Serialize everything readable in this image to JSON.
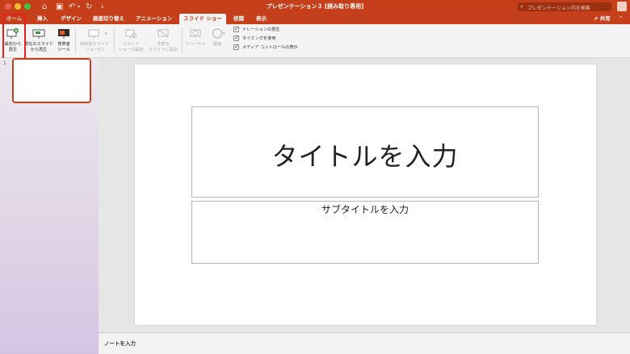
{
  "window": {
    "title": "プレゼンテーション３ [読み取り専用]",
    "search_placeholder": "プレゼンテーション内を検索"
  },
  "tabs": [
    {
      "label": "挿入"
    },
    {
      "label": "デザイン"
    },
    {
      "label": "画面切り替え"
    },
    {
      "label": "アニメーション"
    },
    {
      "label": "スライド ショー",
      "active": true
    },
    {
      "label": "校閲"
    },
    {
      "label": "表示"
    }
  ],
  "share_label": "共有",
  "ribbon": {
    "buttons": [
      {
        "label_line1": "最初から",
        "label_line2": "再生",
        "icon": "play-from-start-icon",
        "enabled": true
      },
      {
        "label_line1": "現在のスライド",
        "label_line2": "から再生",
        "icon": "play-from-current-icon",
        "enabled": true
      },
      {
        "label_line1": "発表者",
        "label_line2": "ツール",
        "icon": "presenter-view-icon",
        "enabled": true
      },
      {
        "label_line1": "目的別スライド",
        "label_line2": "ショー(C)",
        "icon": "custom-show-icon",
        "enabled": false
      },
      {
        "label_line1": "スライド",
        "label_line2": "ショーの設定",
        "icon": "setup-show-icon",
        "enabled": false
      },
      {
        "label_line1": "非表示",
        "label_line2": "スライドに設定",
        "icon": "hide-slide-icon",
        "enabled": false
      },
      {
        "label_line1": "リハーサル",
        "label_line2": "",
        "icon": "rehearse-icon",
        "enabled": false
      },
      {
        "label_line1": "録画",
        "label_line2": "",
        "icon": "record-icon",
        "enabled": false
      }
    ],
    "checkboxes": [
      {
        "label": "ナレーションの再生",
        "checked": true
      },
      {
        "label": "タイミングを使用",
        "checked": true
      },
      {
        "label": "メディア コントロールの表示",
        "checked": true
      }
    ]
  },
  "thumbnails": {
    "slide_number": "1"
  },
  "slide": {
    "title_placeholder": "タイトルを入力",
    "subtitle_placeholder": "サブタイトルを入力"
  },
  "notes_placeholder": "ノートを入力",
  "colors": {
    "accent": "#c5401a",
    "highlight": "#e8201c"
  }
}
